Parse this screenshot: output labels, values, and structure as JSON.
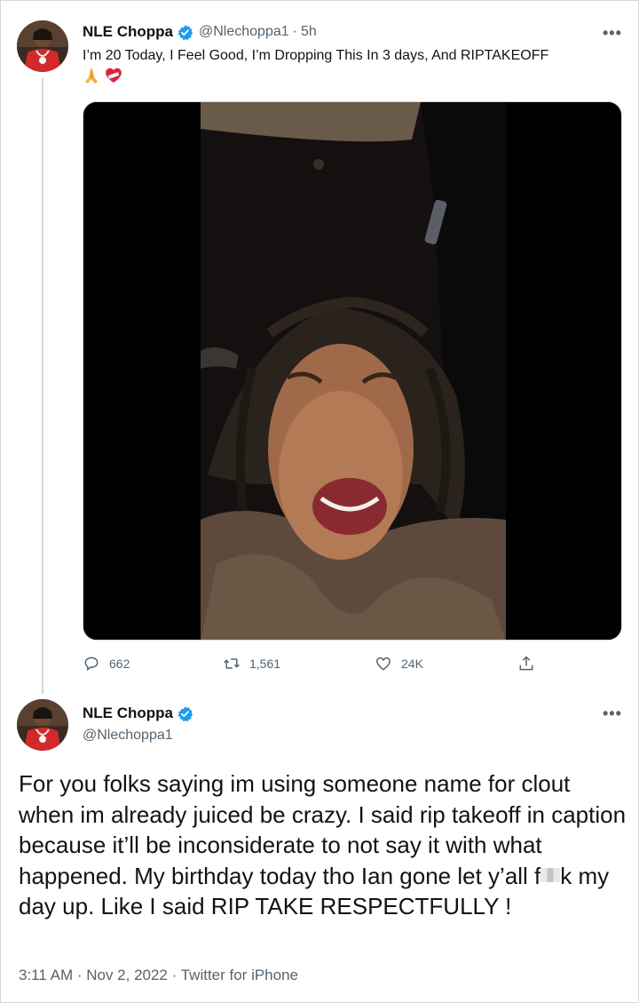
{
  "tweet1": {
    "display_name": "NLE Choppa",
    "handle": "@Nlechoppa1",
    "separator": "·",
    "time": "5h",
    "more_label": "•••",
    "text": "I’m 20 Today, I Feel Good, I’m Dropping This In 3 days, And RIPTAKEOFF",
    "emojis": [
      "folded-hands-emoji",
      "mending-heart-emoji"
    ],
    "media": "video",
    "actions": {
      "reply_count": "662",
      "retweet_count": "1,561",
      "like_count": "24K"
    }
  },
  "tweet2": {
    "display_name": "NLE Choppa",
    "handle": "@Nlechoppa1",
    "more_label": "•••",
    "text_before_censor": "For you folks saying im using someone name for clout when im already juiced be crazy. I said rip takeoff in caption because it’ll be inconsiderate to not say it with what happened. My birthday today tho Ian gone let y’all f",
    "text_after_censor": "k my day up. Like I said RIP TAKE RESPECTFULLY !",
    "timestamp": "3:11 AM · Nov 2, 2022",
    "source": "Twitter for iPhone"
  },
  "colors": {
    "verified": "#1d9bf0",
    "secondary_text": "#536471",
    "border": "#cfd9de"
  }
}
